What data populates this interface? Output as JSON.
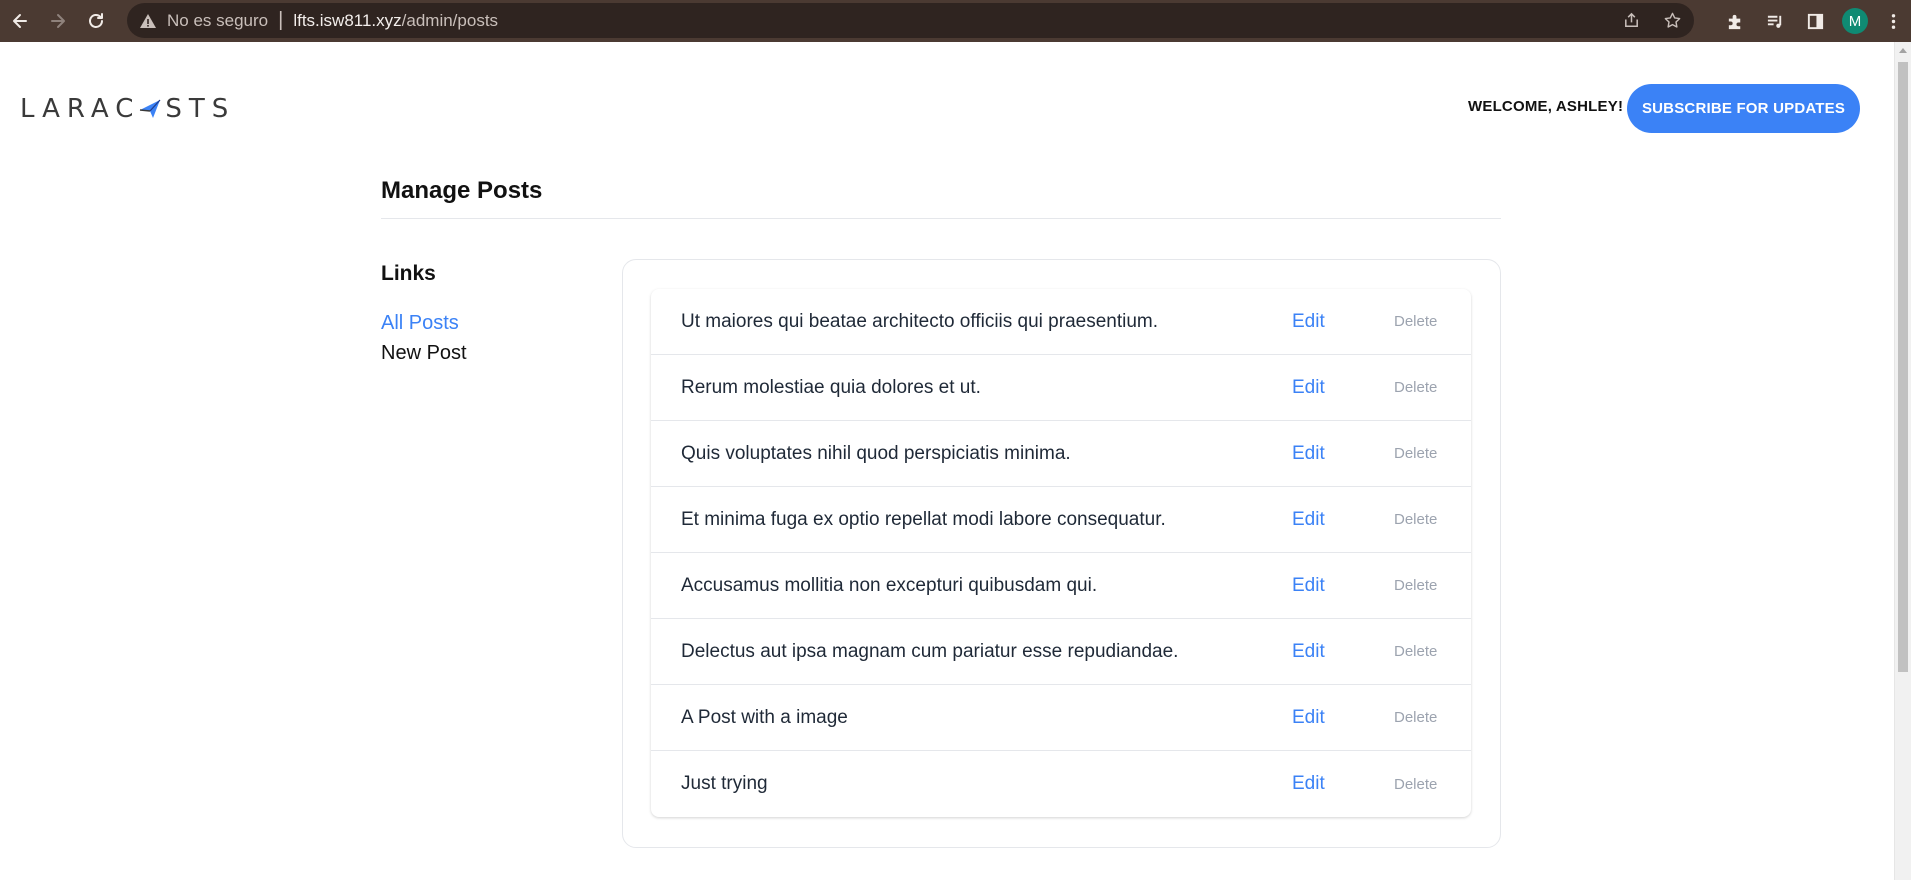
{
  "browser": {
    "security_label": "No es seguro",
    "url_host": "lfts.isw811.xyz",
    "url_path": "/admin/posts",
    "profile_initial": "M"
  },
  "site": {
    "logo_text_left": "LARAC",
    "logo_text_right": "STS",
    "welcome": "WELCOME, ASHLEY!",
    "subscribe_label": "SUBSCRIBE FOR UPDATES"
  },
  "page": {
    "title": "Manage Posts"
  },
  "sidebar": {
    "heading": "Links",
    "links": [
      {
        "label": "All Posts",
        "active": true
      },
      {
        "label": "New Post",
        "active": false
      }
    ]
  },
  "posts": [
    {
      "title": "Ut maiores qui beatae architecto officiis qui praesentium.",
      "edit": "Edit",
      "delete": "Delete"
    },
    {
      "title": "Rerum molestiae quia dolores et ut.",
      "edit": "Edit",
      "delete": "Delete"
    },
    {
      "title": "Quis voluptates nihil quod perspiciatis minima.",
      "edit": "Edit",
      "delete": "Delete"
    },
    {
      "title": "Et minima fuga ex optio repellat modi labore consequatur.",
      "edit": "Edit",
      "delete": "Delete"
    },
    {
      "title": "Accusamus mollitia non excepturi quibusdam qui.",
      "edit": "Edit",
      "delete": "Delete"
    },
    {
      "title": "Delectus aut ipsa magnam cum pariatur esse repudiandae.",
      "edit": "Edit",
      "delete": "Delete"
    },
    {
      "title": "A Post with a image",
      "edit": "Edit",
      "delete": "Delete"
    },
    {
      "title": "Just trying",
      "edit": "Edit",
      "delete": "Delete"
    }
  ],
  "colors": {
    "accent": "#3b82f6",
    "chrome": "#4b3a32",
    "muted": "#9ca3af"
  }
}
